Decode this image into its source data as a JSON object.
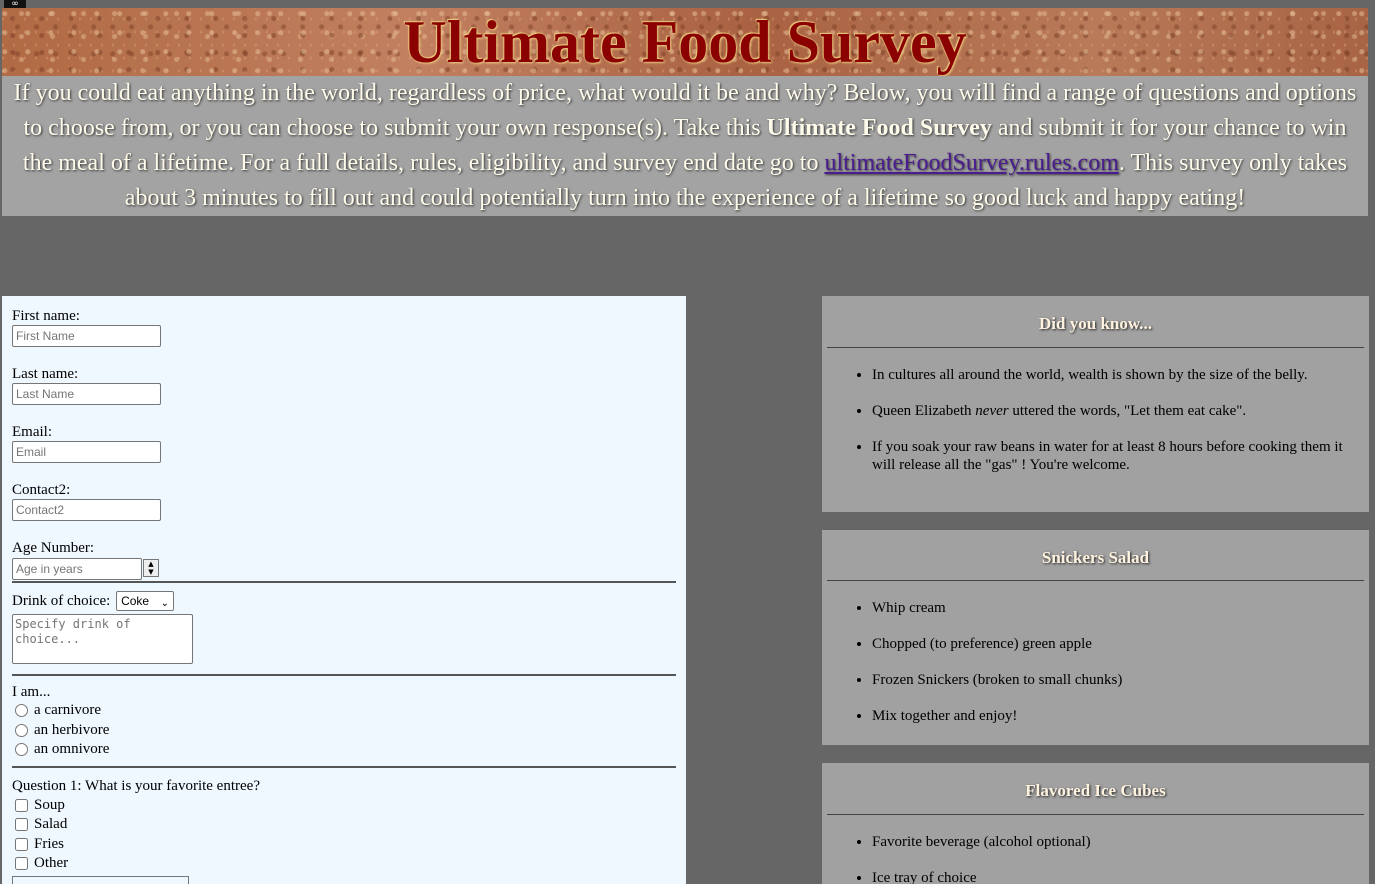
{
  "corner_badge": "∞",
  "header": {
    "title": "Ultimate Food Survey"
  },
  "intro": {
    "text_before_bold": "If you could eat anything in the world, regardless of price, what would it be and why? Below, you will find a range of questions and options to choose from, or you can choose to submit your own response(s). Take this ",
    "bold": "Ultimate Food Survey",
    "text_before_link": " and submit it for your chance to win the meal of a lifetime. For a full details, rules, eligibility, and survey end date go to ",
    "link": "ultimateFoodSurvey.rules.com",
    "text_after_link": ". This survey only takes about 3 minutes to fill out and could potentially turn into the experience of a lifetime so good luck and happy eating!"
  },
  "form": {
    "first_name": {
      "label": "First name:",
      "placeholder": "First Name"
    },
    "last_name": {
      "label": "Last name:",
      "placeholder": "Last Name"
    },
    "email": {
      "label": "Email:",
      "placeholder": "Email"
    },
    "contact2": {
      "label": "Contact2:",
      "placeholder": "Contact2"
    },
    "age": {
      "label": "Age Number:",
      "placeholder": "Age in years"
    },
    "drink": {
      "label": "Drink of choice:",
      "selected": "Coke",
      "textarea_placeholder": "Specify drink of choice..."
    },
    "diet": {
      "label": "I am...",
      "options": [
        "a carnivore",
        "an herbivore",
        "an omnivore"
      ]
    },
    "question1": {
      "label": "Question 1: What is your favorite entree?",
      "options": [
        "Soup",
        "Salad",
        "Fries",
        "Other"
      ]
    }
  },
  "cards": [
    {
      "title": "Did you know...",
      "items": [
        "In cultures all around the world, wealth is shown by the size of the belly.",
        "Queen Elizabeth never uttered the words, \"Let them eat cake\".",
        "If you soak your raw beans in water for at least 8 hours before cooking them it will release all the \"gas\" ! You're welcome."
      ]
    },
    {
      "title": "Snickers Salad",
      "items": [
        "Whip cream",
        "Chopped (to preference) green apple",
        "Frozen Snickers (broken to small chunks)",
        "Mix together and enjoy!"
      ]
    },
    {
      "title": "Flavored Ice Cubes",
      "items": [
        "Favorite beverage (alcohol optional)",
        "Ice tray of choice"
      ]
    }
  ]
}
